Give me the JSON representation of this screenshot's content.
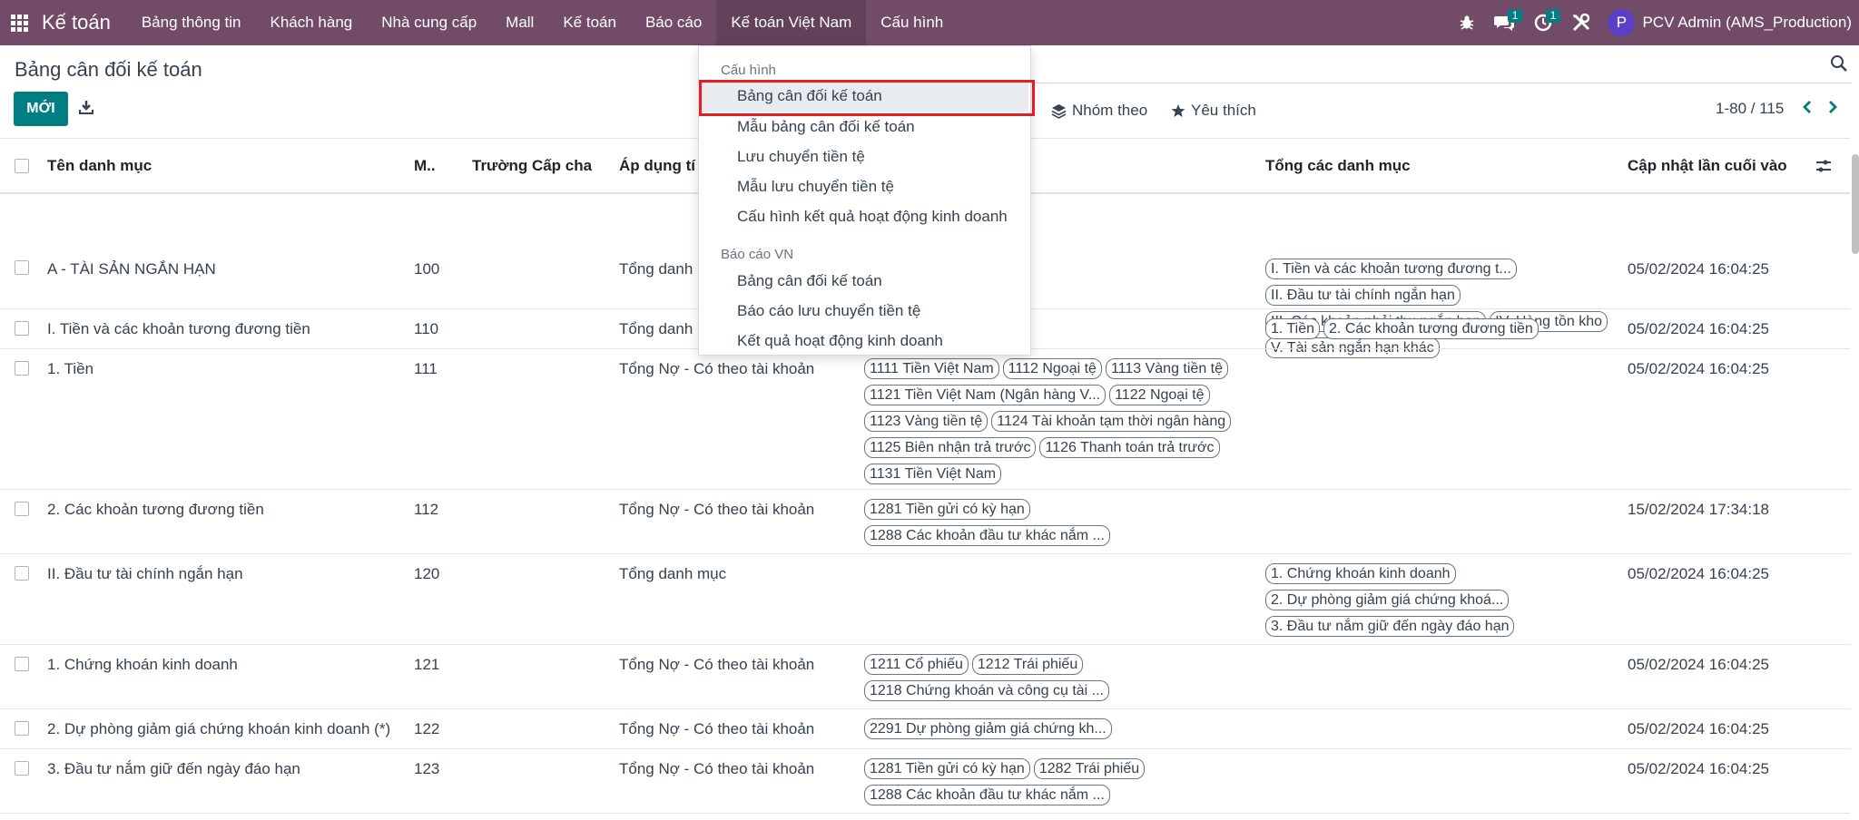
{
  "navbar": {
    "app_name": "Kế toán",
    "menu": [
      "Bảng thông tin",
      "Khách hàng",
      "Nhà cung cấp",
      "Mall",
      "Kế toán",
      "Báo cáo",
      "Kế toán Việt Nam",
      "Cấu hình"
    ],
    "active_menu": "Kế toán Việt Nam",
    "messages_count": "1",
    "activities_count": "1",
    "avatar_letter": "P",
    "user_name": "PCV Admin (AMS_Production)",
    "brand_color": "#714B67"
  },
  "control": {
    "title": "Bảng cân đối kế toán",
    "new_button": "MỚI",
    "group_by": "Nhóm theo",
    "favorites": "Yêu thích",
    "pager": "1-80 / 115"
  },
  "table": {
    "headers": {
      "name": "Tên danh mục",
      "code": "M..",
      "parent": "Trường Cấp cha",
      "apply": "Áp dụng tí",
      "sum": "Tổng các danh mục",
      "updated": "Cập nhật lần cuối vào"
    },
    "rows": [
      {
        "name": "A - TÀI SẢN NGẮN HẠN",
        "code": "100",
        "apply": "Tổng danh",
        "accounts": [],
        "sums": [
          "I. Tiền và các khoản tương đương t...",
          "II. Đầu tư tài chính ngắn hạn",
          "III. Các khoản phải thu ngắn hạn",
          "IV. Hàng tồn kho",
          "V. Tài sản ngắn hạn khác"
        ],
        "updated": "05/02/2024 16:04:25"
      },
      {
        "name": "I. Tiền và các khoản tương đương tiền",
        "code": "110",
        "apply": "Tổng danh",
        "accounts": [],
        "sums": [
          "1. Tiền",
          "2. Các khoản tương đương tiền"
        ],
        "updated": "05/02/2024 16:04:25"
      },
      {
        "name": "1. Tiền",
        "code": "111",
        "apply": "Tổng Nợ - Có theo tài khoản",
        "accounts": [
          "1111 Tiền Việt Nam",
          "1112 Ngoại tệ",
          "1113 Vàng tiền tệ",
          "1121 Tiền Việt Nam (Ngân hàng V...",
          "1122 Ngoại tệ",
          "1123 Vàng tiền tệ",
          "1124 Tài khoản tạm thời ngân hàng",
          "1125 Biên nhận trả trước",
          "1126 Thanh toán trả trước",
          "1131 Tiền Việt Nam"
        ],
        "sums": [],
        "updated": "05/02/2024 16:04:25"
      },
      {
        "name": "2. Các khoản tương đương tiền",
        "code": "112",
        "apply": "Tổng Nợ - Có theo tài khoản",
        "accounts": [
          "1281 Tiền gửi có kỳ hạn",
          "1288 Các khoản đầu tư khác nắm ..."
        ],
        "sums": [],
        "updated": "15/02/2024 17:34:18"
      },
      {
        "name": "II. Đầu tư tài chính ngắn hạn",
        "code": "120",
        "apply": "Tổng danh mục",
        "accounts": [],
        "sums": [
          "1. Chứng khoán kinh doanh",
          "2. Dự phòng giảm giá chứng khoá...",
          "3. Đầu tư nắm giữ đến ngày đáo hạn"
        ],
        "updated": "05/02/2024 16:04:25"
      },
      {
        "name": "1. Chứng khoán kinh doanh",
        "code": "121",
        "apply": "Tổng Nợ - Có theo tài khoản",
        "accounts": [
          "1211 Cổ phiếu",
          "1212 Trái phiếu",
          "1218 Chứng khoán và công cụ tài ..."
        ],
        "sums": [],
        "updated": "05/02/2024 16:04:25"
      },
      {
        "name": "2. Dự phòng giảm giá chứng khoán kinh doanh (*)",
        "code": "122",
        "apply": "Tổng Nợ - Có theo tài khoản",
        "accounts": [
          "2291 Dự phòng giảm giá chứng kh..."
        ],
        "sums": [],
        "updated": "05/02/2024 16:04:25"
      },
      {
        "name": "3. Đầu tư nắm giữ đến ngày đáo hạn",
        "code": "123",
        "apply": "Tổng Nợ - Có theo tài khoản",
        "accounts": [
          "1281 Tiền gửi có kỳ hạn",
          "1282 Trái phiếu",
          "1288 Các khoản đầu tư khác nắm ..."
        ],
        "sums": [],
        "updated": "05/02/2024 16:04:25"
      }
    ]
  },
  "dropdown": {
    "section1": "Cấu hình",
    "items1": [
      "Bảng cân đối kế toán",
      "Mẫu bảng cân đối kế toán",
      "Lưu chuyển tiền tệ",
      "Mẫu lưu chuyển tiền tệ",
      "Cấu hình kết quả hoạt động kinh doanh"
    ],
    "section2": "Báo cáo VN",
    "items2": [
      "Bảng cân đối kế toán",
      "Báo cáo lưu chuyển tiền tệ",
      "Kết quả hoạt động kinh doanh"
    ],
    "highlight_color": "#e31e24"
  }
}
